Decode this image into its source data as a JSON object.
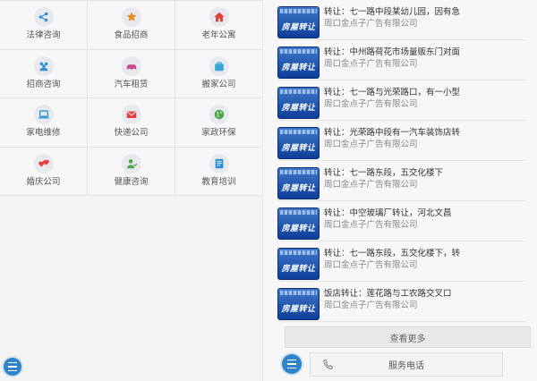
{
  "categories": [
    {
      "label": "法律咨询",
      "icon": "share-icon",
      "color": "#2f8fd6"
    },
    {
      "label": "食品招商",
      "icon": "star-icon",
      "color": "#f08a1c"
    },
    {
      "label": "老年公寓",
      "icon": "house-icon",
      "color": "#e2403a"
    },
    {
      "label": "招商咨询",
      "icon": "people-icon",
      "color": "#2f8fd6"
    },
    {
      "label": "汽车租赁",
      "icon": "car-icon",
      "color": "#c94a8e"
    },
    {
      "label": "搬家公司",
      "icon": "bag-icon",
      "color": "#35a6d4"
    },
    {
      "label": "家电维修",
      "icon": "laptop-icon",
      "color": "#2f8fd6"
    },
    {
      "label": "快递公司",
      "icon": "mail-icon",
      "color": "#e2403a"
    },
    {
      "label": "家政环保",
      "icon": "globe-icon",
      "color": "#4aa84a"
    },
    {
      "label": "婚庆公司",
      "icon": "hearts-icon",
      "color": "#e2403a"
    },
    {
      "label": "健康咨询",
      "icon": "person-icon",
      "color": "#4aa84a"
    },
    {
      "label": "教育培训",
      "icon": "document-icon",
      "color": "#2f8fd6"
    }
  ],
  "listings": [
    {
      "badge": "房屋转让",
      "title": "转让：七一路中段某幼儿园，因有急",
      "company": "周口金点子广告有限公司"
    },
    {
      "badge": "房屋转让",
      "title": "转让：中州路荷花市场量贩东门对面",
      "company": "周口金点子广告有限公司"
    },
    {
      "badge": "房屋转让",
      "title": "转让：七一路与光荣路口，有一小型",
      "company": "周口金点子广告有限公司"
    },
    {
      "badge": "房屋转让",
      "title": "转让：光荣路中段有一汽车装饰店转",
      "company": "周口金点子广告有限公司"
    },
    {
      "badge": "房屋转让",
      "title": "转让：七一路东段，五交化楼下",
      "company": "周口金点子广告有限公司"
    },
    {
      "badge": "房屋转让",
      "title": "转让：中空玻璃厂转让，河北文昌",
      "company": "周口金点子广告有限公司"
    },
    {
      "badge": "房屋转让",
      "title": "转让：七一路东段，五交化楼下，转",
      "company": "周口金点子广告有限公司"
    },
    {
      "badge": "房屋转让",
      "title": "饭店转让：莲花路与工农路交叉口",
      "company": "周口金点子广告有限公司"
    }
  ],
  "more_label": "查看更多",
  "phone_label": "服务电话",
  "accent": "#2f84c8"
}
